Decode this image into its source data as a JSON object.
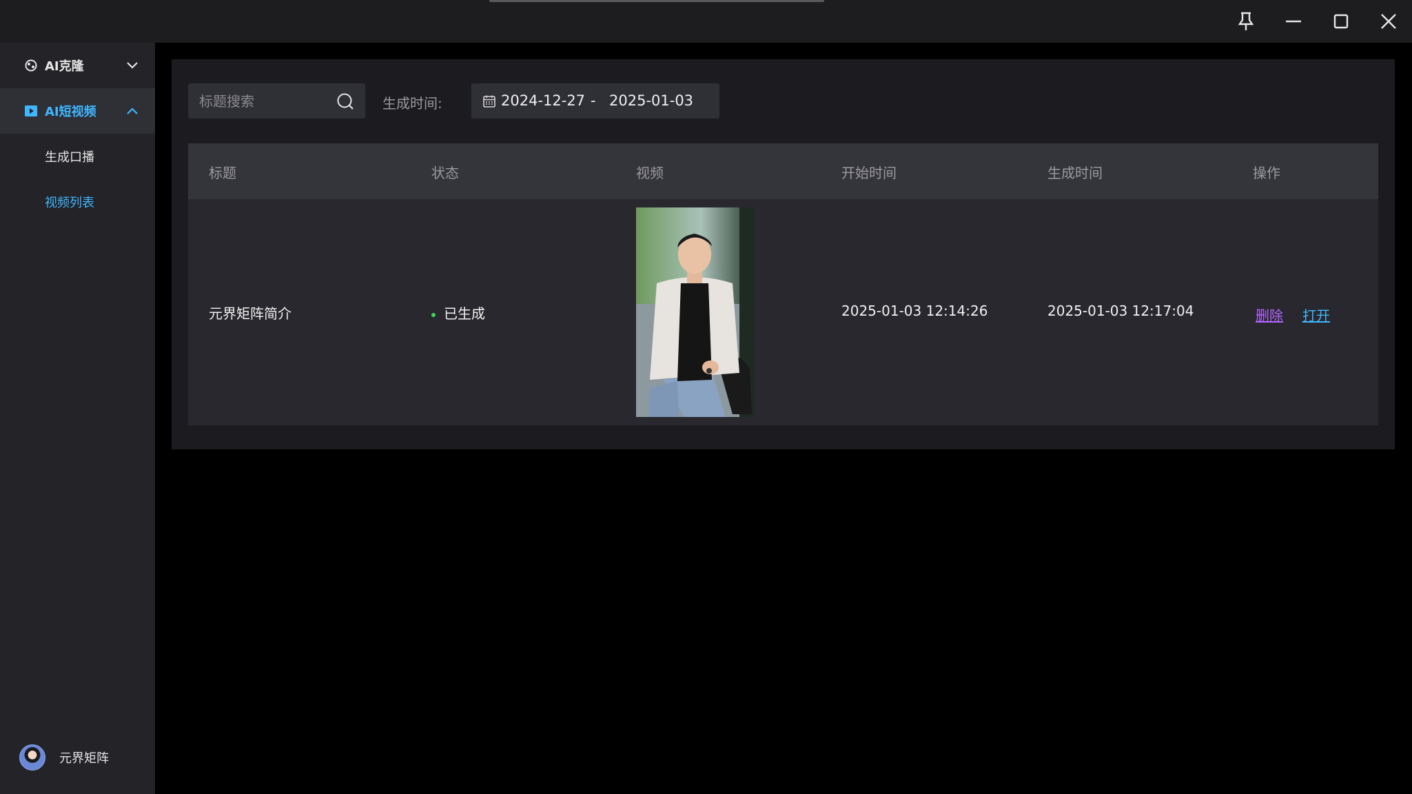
{
  "window": {
    "controls": {
      "pin_icon": "pin-icon",
      "minimize_icon": "minimize-icon",
      "maximize_icon": "maximize-icon",
      "close_icon": "close-icon"
    }
  },
  "sidebar": {
    "groups": [
      {
        "label": "AI克隆",
        "icon": "clone-icon",
        "expanded": false
      },
      {
        "label": "AI短视频",
        "icon": "video-icon",
        "expanded": true,
        "active": true
      }
    ],
    "subitems": [
      {
        "label": "生成口播",
        "selected": false
      },
      {
        "label": "视频列表",
        "selected": true
      }
    ],
    "user": {
      "name": "元界矩阵"
    }
  },
  "filters": {
    "search": {
      "placeholder": "标题搜索",
      "value": ""
    },
    "date_label": "生成时间:",
    "date_start": "2024-12-27",
    "date_separator": "-",
    "date_end": "2025-01-03"
  },
  "table": {
    "headers": [
      "标题",
      "状态",
      "视频",
      "开始时间",
      "生成时间",
      "操作"
    ],
    "rows": [
      {
        "title": "元界矩阵简介",
        "status": "已生成",
        "video_thumbnail": "person-thumbnail",
        "start_time": "2025-01-03 12:14:26",
        "generated_time": "2025-01-03 12:17:04",
        "actions": {
          "delete": "删除",
          "open": "打开"
        }
      }
    ]
  },
  "colors": {
    "accent": "#3fb7ff",
    "status_ok": "#3dd35a",
    "delete_link": "#b666ff",
    "open_link": "#3fb7ff"
  }
}
